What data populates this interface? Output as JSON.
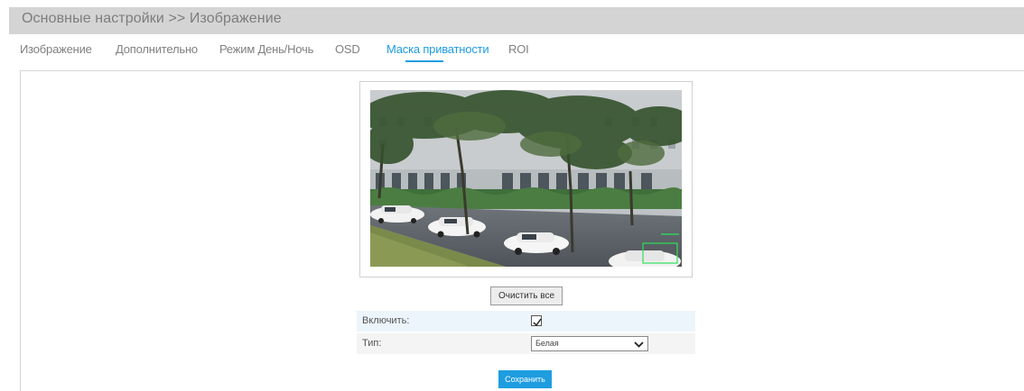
{
  "header": {
    "title": "Основные настройки >> Изображение"
  },
  "tabs": [
    {
      "label": "Изображение",
      "active": false
    },
    {
      "label": "Дополнительно",
      "active": false
    },
    {
      "label": "Режим День/Ночь",
      "active": false
    },
    {
      "label": "OSD",
      "active": false
    },
    {
      "label": "Маска приватности",
      "active": true
    },
    {
      "label": "ROI",
      "active": false
    }
  ],
  "preview": {
    "alt": "camera-live-preview"
  },
  "actions": {
    "clear_all_label": "Очистить все",
    "save_label": "Сохранить"
  },
  "form": {
    "enable": {
      "label": "Включить:",
      "checked": true
    },
    "type": {
      "label": "Тип:",
      "value": "Белая"
    }
  },
  "colors": {
    "accent": "#1f9ce0",
    "header_bg": "#d4d4d4",
    "row_highlight": "#ecf5fb"
  }
}
